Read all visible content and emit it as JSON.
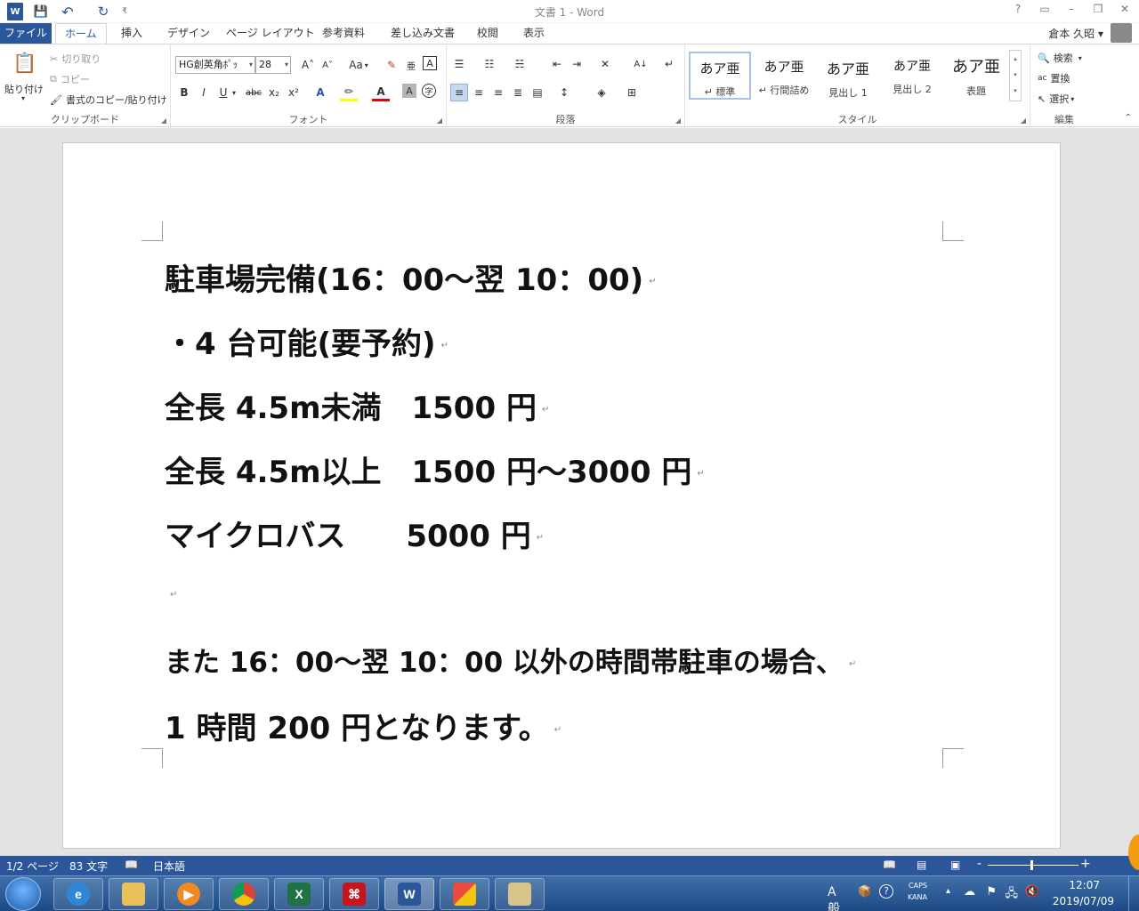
{
  "title_bar": {
    "document_title": "文書 1 - Word",
    "help": "?",
    "ribbon_display": "▭",
    "minimize": "–",
    "restore": "❐",
    "close": "✕"
  },
  "quick_access": {
    "word_icon": "W",
    "save": "💾",
    "undo": "↶",
    "redo": "↻",
    "customize": "₹"
  },
  "tabs": [
    "ファイル",
    "ホーム",
    "挿入",
    "デザイン",
    "ページ レイアウト",
    "参考資料",
    "差し込み文書",
    "校閲",
    "表示"
  ],
  "user_name": "倉本 久昭",
  "ribbon": {
    "clipboard": {
      "paste": "貼り付け",
      "cut": "切り取り",
      "copy": "コピー",
      "format_painter": "書式のコピー/貼り付け",
      "label": "クリップボード"
    },
    "font": {
      "font_name": "HG創英角ﾎﾟｯ",
      "font_size": "28",
      "grow": "A˄",
      "shrink": "A˅",
      "change_case": "Aa",
      "bold": "B",
      "italic": "I",
      "underline": "U",
      "strike": "abc",
      "subscript": "x₂",
      "superscript": "x²",
      "label": "フォント"
    },
    "paragraph": {
      "label": "段落"
    },
    "styles": {
      "items": [
        {
          "preview": "あア亜",
          "name": "↵ 標準"
        },
        {
          "preview": "あア亜",
          "name": "↵ 行間詰め"
        },
        {
          "preview": "あア亜",
          "name": "見出し 1"
        },
        {
          "preview": "あア亜",
          "name": "見出し 2"
        },
        {
          "preview": "あア亜",
          "name": "表題"
        }
      ],
      "label": "スタイル"
    },
    "editing": {
      "find": "検索",
      "replace": "置換",
      "select": "選択",
      "label": "編集"
    }
  },
  "document": {
    "lines": [
      "駐車場完備(16：00～翌 10：00)",
      "・4 台可能(要予約)",
      "全長 4.5m未満　1500 円",
      "全長 4.5m以上　1500 円～3000 円",
      "マイクロバス　　5000 円",
      "",
      "また 16：00～翌 10：00 以外の時間帯駐車の場合、",
      "1 時間 200 円となります。"
    ],
    "paragraph_mark": "↵"
  },
  "status_bar": {
    "page": "1/2 ページ",
    "words": "83 文字",
    "language": "日本語"
  },
  "taskbar": {
    "apps": [
      "ie-icon",
      "explorer-icon",
      "media-icon",
      "chrome-icon",
      "excel-icon",
      "acrobat-icon",
      "word-icon",
      "office-icon",
      "window-icon"
    ],
    "ime_mode": "A 般",
    "caps": "CAPS",
    "kana": "KANA",
    "time": "12:07",
    "date": "2019/07/09"
  }
}
